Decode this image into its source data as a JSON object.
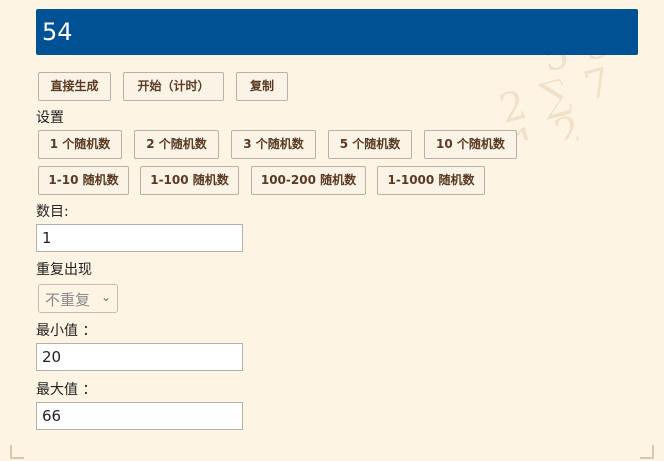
{
  "result": {
    "value": "54"
  },
  "actions": {
    "direct_generate": "直接生成",
    "start_timed": "开始（计时）",
    "copy": "复制"
  },
  "settings": {
    "heading": "设置",
    "presets_row1": [
      "1 个随机数",
      "2 个随机数",
      "3 个随机数",
      "5 个随机数",
      "10 个随机数"
    ],
    "presets_row2": [
      "1-10 随机数",
      "1-100 随机数",
      "100-200 随机数",
      "1-1000 随机数"
    ]
  },
  "form": {
    "count_label": "数目:",
    "count_value": "1",
    "repeat_label": "重复出现",
    "repeat_selected": "不重复",
    "min_label": "最小值 ：",
    "min_value": "20",
    "max_label": "最大值 ：",
    "max_value": "66"
  },
  "colors": {
    "result_bg": "#005295",
    "page_bg": "#fdf4e3",
    "button_text": "#5a3a22"
  }
}
